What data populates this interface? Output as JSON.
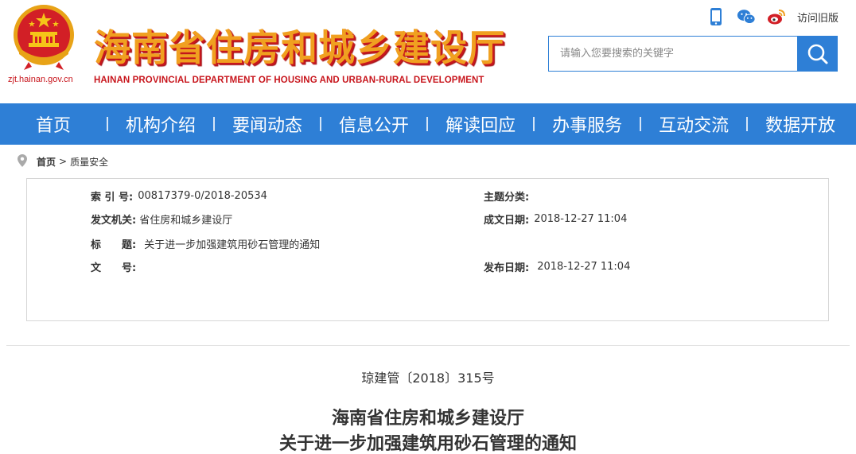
{
  "header": {
    "site_url": "zjt.hainan.gov.cn",
    "site_title": "海南省住房和城乡建设厅",
    "site_subtitle": "HAINAN PROVINCIAL DEPARTMENT OF HOUSING AND URBAN-RURAL DEVELOPMENT",
    "old_version_label": "访问旧版",
    "icons": [
      "mobile-icon",
      "wechat-icon",
      "weibo-icon"
    ]
  },
  "search": {
    "placeholder": "请输入您要搜索的关键字"
  },
  "nav": {
    "items": [
      {
        "label": "首页"
      },
      {
        "label": "机构介绍"
      },
      {
        "label": "要闻动态"
      },
      {
        "label": "信息公开"
      },
      {
        "label": "解读回应"
      },
      {
        "label": "办事服务"
      },
      {
        "label": "互动交流"
      },
      {
        "label": "数据开放"
      }
    ]
  },
  "breadcrumb": {
    "home": "首页",
    "separator": ">",
    "current": "质量安全"
  },
  "meta": {
    "index_label": "索 引 号:",
    "index_value": "00817379-0/2018-20534",
    "topic_label": "主题分类:",
    "topic_value": "",
    "issuer_label": "发文机关:",
    "issuer_value": "省住房和城乡建设厅",
    "created_label": "成文日期:",
    "created_value": "2018-12-27 11:04",
    "title_label": "标　　题:",
    "title_value": "关于进一步加强建筑用砂石管理的通知",
    "docnum_label": "文　　号:",
    "docnum_value": "",
    "published_label": "发布日期:",
    "published_value": "2018-12-27 11:04"
  },
  "document": {
    "doc_number": "琼建管〔2018〕315号",
    "title_line1": "海南省住房和城乡建设厅",
    "title_line2": "关于进一步加强建筑用砂石管理的通知"
  },
  "colors": {
    "primary_blue": "#2e7fd6",
    "title_gold": "#f0a020",
    "emblem_red": "#c8161d"
  }
}
